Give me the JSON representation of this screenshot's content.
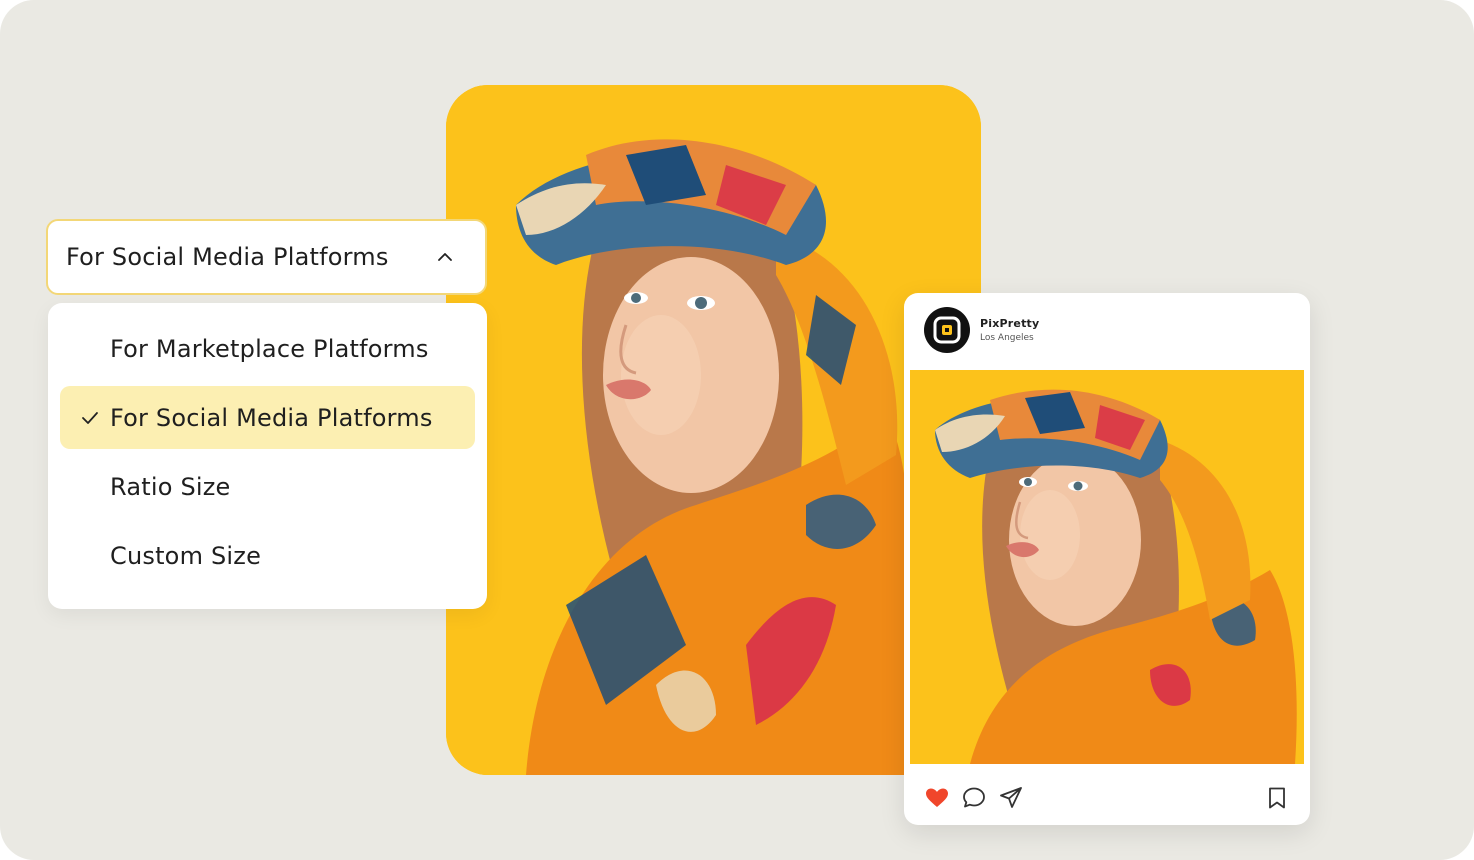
{
  "dropdown": {
    "selected_label": "For Social Media Platforms",
    "options": [
      {
        "label": "For Marketplace Platforms",
        "selected": false
      },
      {
        "label": "For Social Media Platforms",
        "selected": true
      },
      {
        "label": "Ratio Size",
        "selected": false
      },
      {
        "label": "Custom Size",
        "selected": false
      }
    ]
  },
  "post": {
    "account_name": "PixPretty",
    "location": "Los Angeles",
    "liked": true
  },
  "icons": {
    "dropdown_toggle": "chevron-up-icon",
    "selected_marker": "checkmark-icon",
    "like": "heart-icon",
    "comment": "comment-icon",
    "share": "send-icon",
    "save": "bookmark-icon",
    "avatar": "pixpretty-logo"
  },
  "colors": {
    "background": "#eae9e3",
    "photo_background": "#fcc21b",
    "select_border": "#f3d777",
    "selected_option": "#fcefb2",
    "like_red": "#f0462b"
  }
}
